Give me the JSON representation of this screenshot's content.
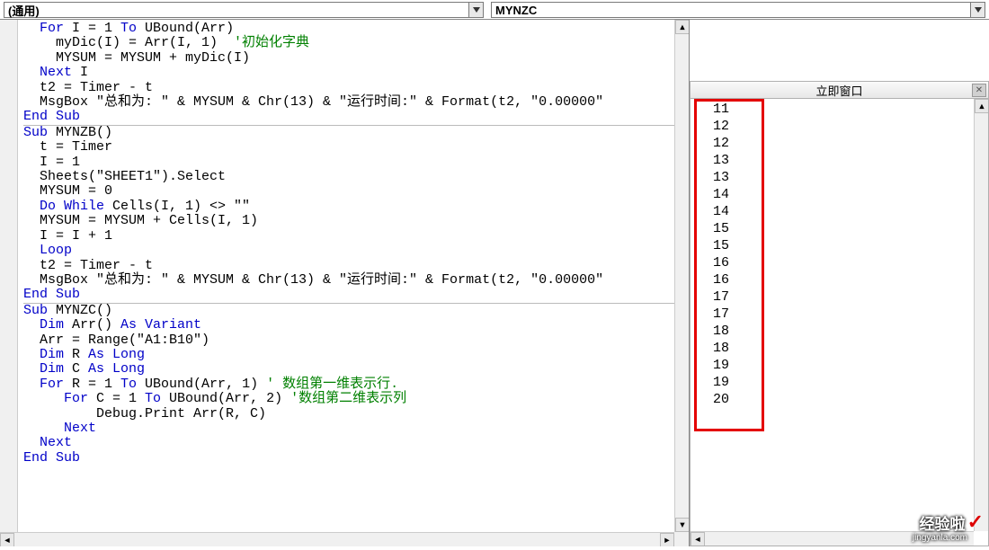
{
  "dropdowns": {
    "left": "(通用)",
    "right": "MYNZC"
  },
  "code": [
    [
      {
        "c": "kw",
        "t": "  For"
      },
      {
        "c": "txt",
        "t": " I = 1 "
      },
      {
        "c": "kw",
        "t": "To"
      },
      {
        "c": "txt",
        "t": " UBound(Arr)"
      }
    ],
    [
      {
        "c": "txt",
        "t": "    myDic(I) = Arr(I, 1)  "
      },
      {
        "c": "cmt",
        "t": "'初始化字典"
      }
    ],
    [
      {
        "c": "txt",
        "t": "    MYSUM = MYSUM + myDic(I)"
      }
    ],
    [
      {
        "c": "kw",
        "t": "  Next"
      },
      {
        "c": "txt",
        "t": " I"
      }
    ],
    [
      {
        "c": "txt",
        "t": "  t2 = Timer - t"
      }
    ],
    [
      {
        "c": "txt",
        "t": "  MsgBox \"总和为: \" & MYSUM & Chr(13) & \"运行时间:\" & Format(t2, \"0.00000\""
      }
    ],
    [
      {
        "c": "kw",
        "t": "End Sub"
      }
    ],
    "SEP",
    [
      {
        "c": "kw",
        "t": "Sub"
      },
      {
        "c": "txt",
        "t": " MYNZB()"
      }
    ],
    [
      {
        "c": "txt",
        "t": "  t = Timer"
      }
    ],
    [
      {
        "c": "txt",
        "t": "  I = 1"
      }
    ],
    [
      {
        "c": "txt",
        "t": "  Sheets(\"SHEET1\").Select"
      }
    ],
    [
      {
        "c": "txt",
        "t": "  MYSUM = 0"
      }
    ],
    [
      {
        "c": "kw",
        "t": "  Do While"
      },
      {
        "c": "txt",
        "t": " Cells(I, 1) <> \"\""
      }
    ],
    [
      {
        "c": "txt",
        "t": "  MYSUM = MYSUM + Cells(I, 1)"
      }
    ],
    [
      {
        "c": "txt",
        "t": "  I = I + 1"
      }
    ],
    [
      {
        "c": "kw",
        "t": "  Loop"
      }
    ],
    [
      {
        "c": "txt",
        "t": "  t2 = Timer - t"
      }
    ],
    [
      {
        "c": "txt",
        "t": "  MsgBox \"总和为: \" & MYSUM & Chr(13) & \"运行时间:\" & Format(t2, \"0.00000\""
      }
    ],
    [
      {
        "c": "kw",
        "t": "End Sub"
      }
    ],
    "SEP",
    [
      {
        "c": "kw",
        "t": "Sub"
      },
      {
        "c": "txt",
        "t": " MYNZC()"
      }
    ],
    [
      {
        "c": "kw",
        "t": "  Dim"
      },
      {
        "c": "txt",
        "t": " Arr() "
      },
      {
        "c": "kw",
        "t": "As Variant"
      }
    ],
    [
      {
        "c": "txt",
        "t": "  Arr = Range(\"A1:B10\")"
      }
    ],
    [
      {
        "c": "kw",
        "t": "  Dim"
      },
      {
        "c": "txt",
        "t": " R "
      },
      {
        "c": "kw",
        "t": "As Long"
      }
    ],
    [
      {
        "c": "kw",
        "t": "  Dim"
      },
      {
        "c": "txt",
        "t": " C "
      },
      {
        "c": "kw",
        "t": "As Long"
      }
    ],
    [
      {
        "c": "kw",
        "t": "  For"
      },
      {
        "c": "txt",
        "t": " R = 1 "
      },
      {
        "c": "kw",
        "t": "To"
      },
      {
        "c": "txt",
        "t": " UBound(Arr, 1) "
      },
      {
        "c": "cmt",
        "t": "' 数组第一维表示行."
      }
    ],
    [
      {
        "c": "kw",
        "t": "     For"
      },
      {
        "c": "txt",
        "t": " C = 1 "
      },
      {
        "c": "kw",
        "t": "To"
      },
      {
        "c": "txt",
        "t": " UBound(Arr, 2) "
      },
      {
        "c": "cmt",
        "t": "'数组第二维表示列"
      }
    ],
    [
      {
        "c": "txt",
        "t": "         Debug.Print Arr(R, C)"
      }
    ],
    [
      {
        "c": "kw",
        "t": "     Next"
      }
    ],
    [
      {
        "c": "kw",
        "t": "  Next"
      }
    ],
    [
      {
        "c": "kw",
        "t": "End Sub"
      }
    ]
  ],
  "immediate": {
    "title": "立即窗口",
    "values": [
      " 11",
      " 12",
      " 12",
      " 13",
      " 13",
      " 14",
      " 14",
      " 15",
      " 15",
      " 16",
      " 16",
      " 17",
      " 17",
      " 18",
      " 18",
      " 19",
      " 19",
      " 20"
    ]
  },
  "watermark": {
    "main": "经验啦",
    "sub": "jingyanla.com"
  }
}
